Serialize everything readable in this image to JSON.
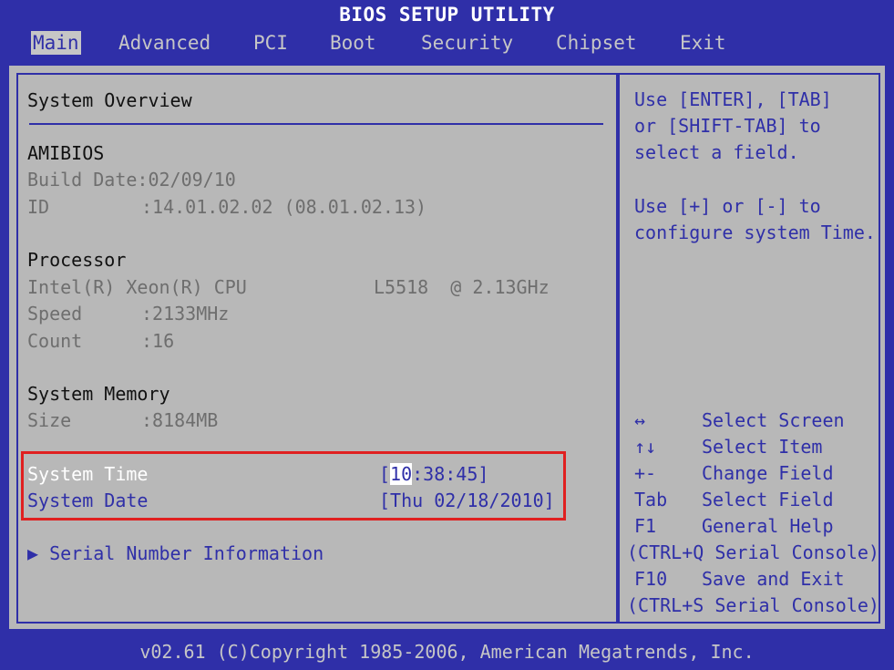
{
  "title": "BIOS SETUP UTILITY",
  "menu": [
    "Main",
    "Advanced",
    "PCI",
    "Boot",
    "Security",
    "Chipset",
    "Exit"
  ],
  "selected_menu": "Main",
  "overview": {
    "heading": "System Overview",
    "amibios": {
      "label": "AMIBIOS",
      "build_date": "Build Date:02/09/10",
      "id_label": "ID",
      "id_value": ":14.01.02.02 (08.01.02.13)"
    },
    "processor": {
      "label": "Processor",
      "cpu_name": "Intel(R) Xeon(R) CPU",
      "cpu_model": "L5518  @ 2.13GHz",
      "speed_label": "Speed",
      "speed_value": ":2133MHz",
      "count_label": "Count",
      "count_value": ":16"
    },
    "memory": {
      "label": "System Memory",
      "size_label": "Size",
      "size_value": ":8184MB"
    },
    "system_time": {
      "label": "System Time",
      "open": "[",
      "hour": "10",
      "rest": ":38:45]"
    },
    "system_date": {
      "label": "System Date",
      "value": "[Thu 02/18/2010]"
    },
    "serial_link": "▶ Serial Number Information"
  },
  "help": {
    "lines": [
      "Use [ENTER], [TAB]",
      "or [SHIFT-TAB] to",
      "select a field.",
      "",
      "Use [+] or [-] to",
      "configure system Time."
    ],
    "keys": [
      {
        "key": "↔",
        "desc": "Select Screen"
      },
      {
        "key": "↑↓",
        "desc": "Select Item"
      },
      {
        "key": "+-",
        "desc": "Change Field"
      },
      {
        "key": "Tab",
        "desc": "Select Field"
      },
      {
        "key": "F1",
        "desc": "General Help"
      },
      {
        "key": "",
        "desc": "(CTRL+Q Serial Console)"
      },
      {
        "key": "F10",
        "desc": "Save and Exit"
      },
      {
        "key": "",
        "desc": "(CTRL+S Serial Console)"
      }
    ]
  },
  "footer": "v02.61 (C)Copyright 1985-2006, American Megatrends, Inc.",
  "colors": {
    "background_blue": "#2f2fa8",
    "panel_grey": "#b8b8b8",
    "highlight_red": "#e02020"
  }
}
